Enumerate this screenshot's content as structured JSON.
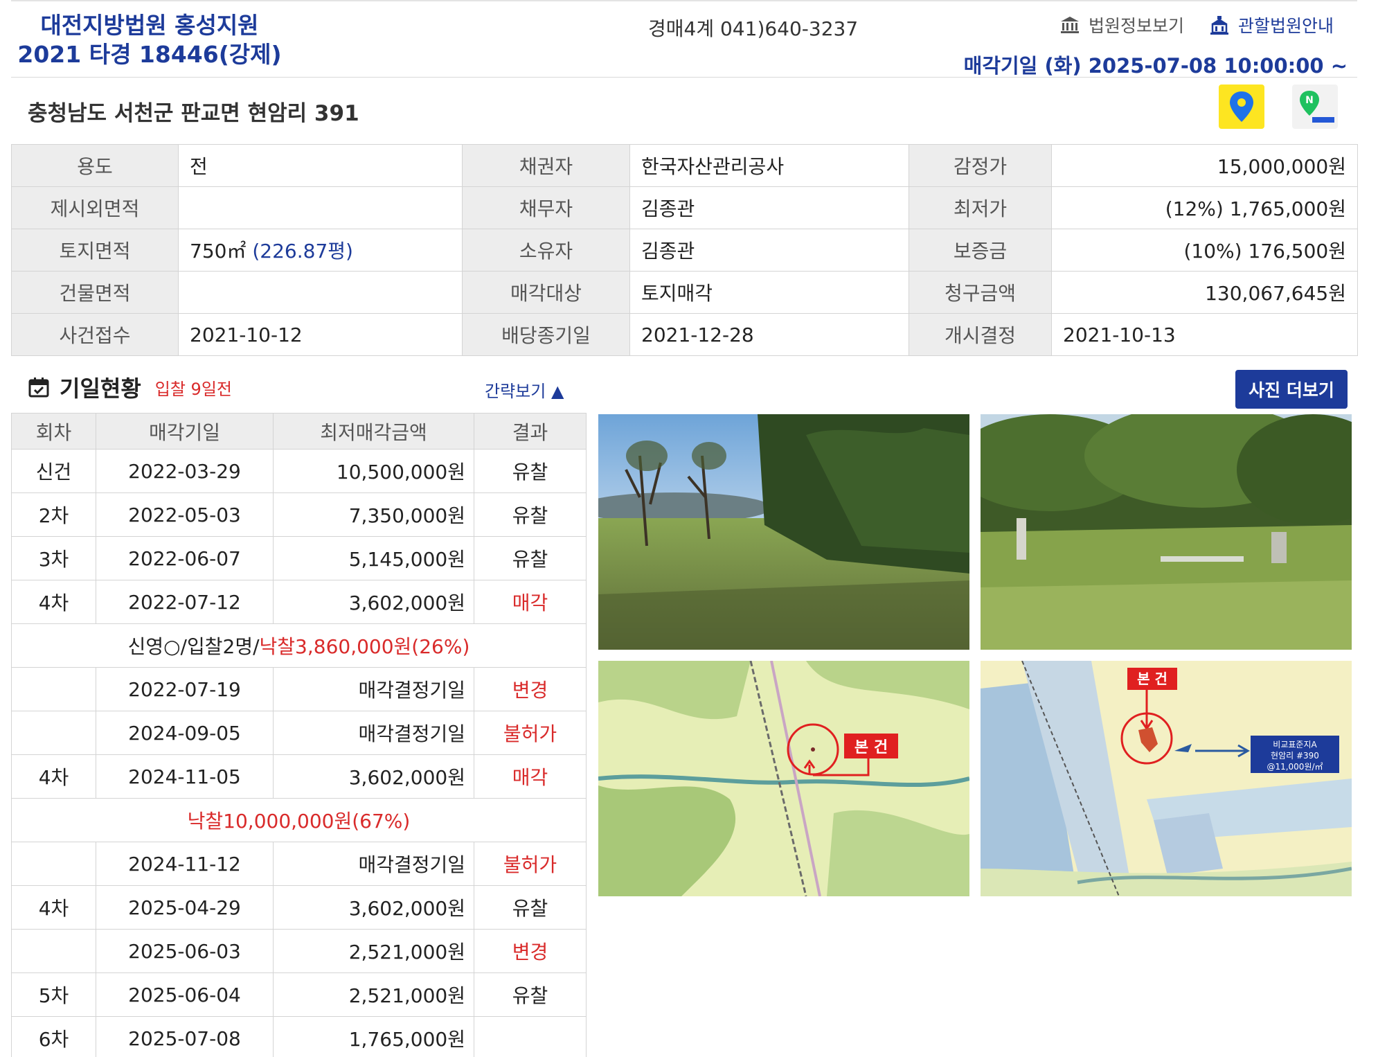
{
  "header": {
    "court_line1": "대전지방법원 홍성지원",
    "court_line2": "2021 타경 18446(강제)",
    "phone": "경매4계 041)640-3237",
    "court_info_link": "법원정보보기",
    "jurisdiction_link": "관할법원안내",
    "sale_datetime": "매각기일  (화) 2025-07-08 10:00:00 ~"
  },
  "address": "충청남도 서천군 판교면 현암리 391",
  "info": {
    "row1": {
      "l1": "용도",
      "v1": "전",
      "l2": "채권자",
      "v2": "한국자산관리공사",
      "l3": "감정가",
      "v3": "15,000,000원"
    },
    "row2": {
      "l1": "제시외면적",
      "v1": "",
      "l2": "채무자",
      "v2": "김종관",
      "l3": "최저가",
      "v3": "(12%) 1,765,000원"
    },
    "row3": {
      "l1": "토지면적",
      "v1a": "750㎡",
      "v1b": "(226.87평)",
      "l2": "소유자",
      "v2": "김종관",
      "l3": "보증금",
      "v3": "(10%) 176,500원"
    },
    "row4": {
      "l1": "건물면적",
      "v1": "",
      "l2": "매각대상",
      "v2": "토지매각",
      "l3": "청구금액",
      "v3": "130,067,645원"
    },
    "row5": {
      "l1": "사건접수",
      "v1": "2021-10-12",
      "l2": "배당종기일",
      "v2": "2021-12-28",
      "l3": "개시결정",
      "v3": "2021-10-13"
    }
  },
  "schedule": {
    "title": "기일현황",
    "subtitle": "입찰 9일전",
    "brief_toggle": "간략보기 ▲",
    "photo_more": "사진 더보기",
    "headers": [
      "회차",
      "매각기일",
      "최저매각금액",
      "결과"
    ],
    "rows": [
      {
        "round": "신건",
        "date": "2022-03-29",
        "amount": "10,500,000원",
        "result": "유찰",
        "red": false
      },
      {
        "round": "2차",
        "date": "2022-05-03",
        "amount": "7,350,000원",
        "result": "유찰",
        "red": false
      },
      {
        "round": "3차",
        "date": "2022-06-07",
        "amount": "5,145,000원",
        "result": "유찰",
        "red": false
      },
      {
        "round": "4차",
        "date": "2022-07-12",
        "amount": "3,602,000원",
        "result": "매각",
        "red": true
      }
    ],
    "span1a": "신영○/입찰2명/",
    "span1b": "낙찰3,860,000원(26%)",
    "rows2": [
      {
        "round": "",
        "date": "2022-07-19",
        "amount": "매각결정기일",
        "result": "변경",
        "red": true
      },
      {
        "round": "",
        "date": "2024-09-05",
        "amount": "매각결정기일",
        "result": "불허가",
        "red": true
      },
      {
        "round": "4차",
        "date": "2024-11-05",
        "amount": "3,602,000원",
        "result": "매각",
        "red": true
      }
    ],
    "span2": "낙찰10,000,000원(67%)",
    "rows3": [
      {
        "round": "",
        "date": "2024-11-12",
        "amount": "매각결정기일",
        "result": "불허가",
        "red": true
      },
      {
        "round": "4차",
        "date": "2025-04-29",
        "amount": "3,602,000원",
        "result": "유찰",
        "red": false
      },
      {
        "round": "",
        "date": "2025-06-03",
        "amount": "2,521,000원",
        "result": "변경",
        "red": true
      },
      {
        "round": "5차",
        "date": "2025-06-04",
        "amount": "2,521,000원",
        "result": "유찰",
        "red": false
      },
      {
        "round": "6차",
        "date": "2025-07-08",
        "amount": "1,765,000원",
        "result": "",
        "red": false
      }
    ]
  },
  "maps": {
    "label": "본 건",
    "compare_line1": "비교표준지A",
    "compare_line2": "현암리 #390",
    "compare_line3": "@11,000원/㎡"
  },
  "colors": {
    "brand": "#1d3b9a",
    "alert": "#d92a2a",
    "label_bg": "#ededed"
  }
}
